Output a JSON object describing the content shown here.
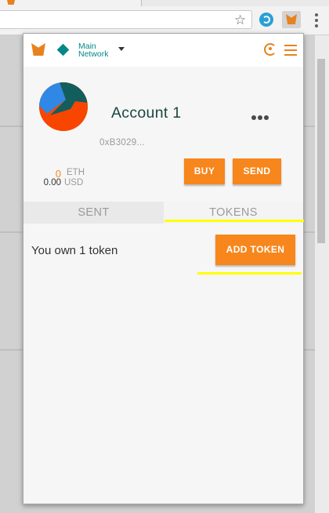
{
  "browser": {
    "star_icon": "star-icon",
    "extensions": [
      "sync-extension-icon",
      "metamask-fox-icon"
    ]
  },
  "header": {
    "network_line1": "Main",
    "network_line2": "Network",
    "network_color": "#038789",
    "accent_color": "#f7861c"
  },
  "account": {
    "name": "Account 1",
    "address": "0xB3029..."
  },
  "balance": {
    "eth_value": "0",
    "eth_unit": "ETH",
    "usd_value": "0.00",
    "usd_unit": "USD"
  },
  "actions": {
    "buy_label": "BUY",
    "send_label": "SEND"
  },
  "tabs": [
    {
      "label": "SENT",
      "active": false
    },
    {
      "label": "TOKENS",
      "active": true
    }
  ],
  "tokens": {
    "owned_text": "You own 1 token",
    "add_label": "ADD TOKEN"
  }
}
